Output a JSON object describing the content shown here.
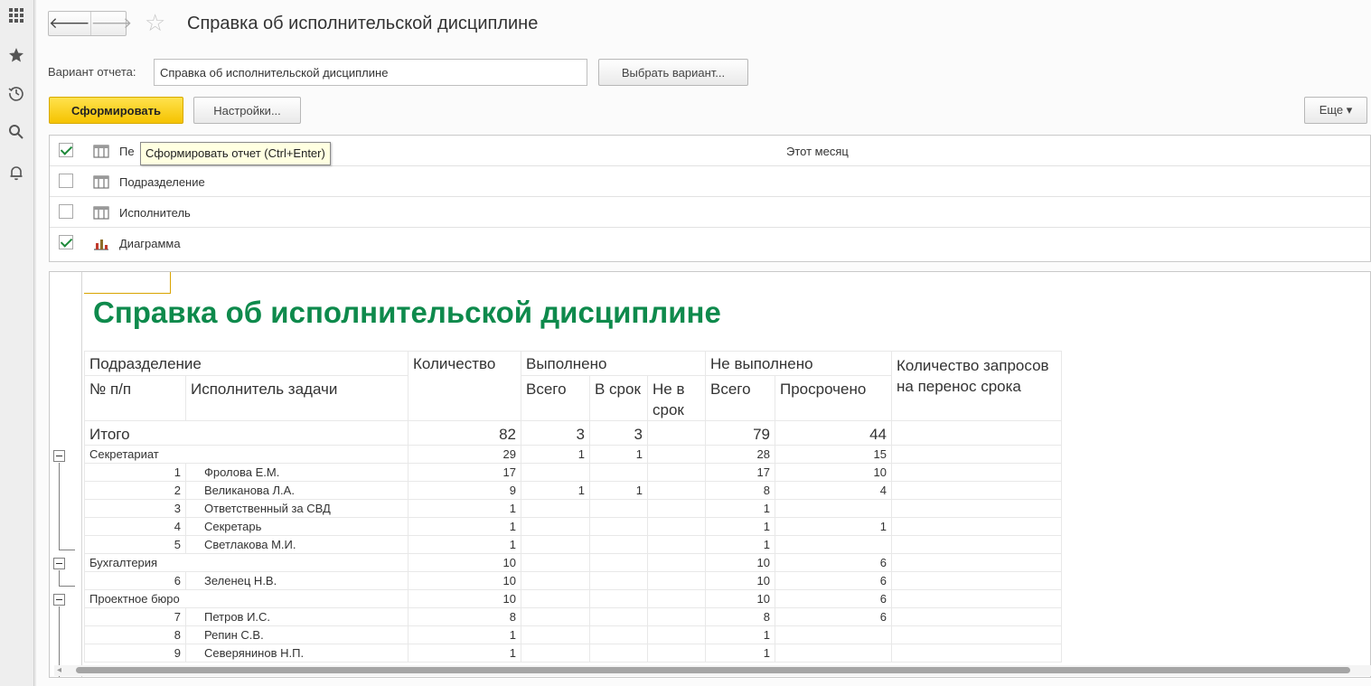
{
  "side_panel": {
    "items": [
      {
        "icon": "apps-grid-icon"
      },
      {
        "icon": "favorites-star-icon"
      },
      {
        "icon": "history-icon"
      },
      {
        "icon": "search-icon"
      },
      {
        "icon": "notifications-bell-icon"
      }
    ]
  },
  "header": {
    "back_glyph": "🡐",
    "forward_glyph": "🡒",
    "favorite_glyph": "☆",
    "title": "Справка об исполнительской дисциплине"
  },
  "variant": {
    "label": "Вариант отчета:",
    "value": "Справка об исполнительской дисциплине",
    "choose_label": "Выбрать вариант..."
  },
  "toolbar": {
    "generate_label": "Сформировать",
    "settings_label": "Настройки...",
    "more_label": "Еще ▾",
    "tooltip": "Сформировать отчет (Ctrl+Enter)"
  },
  "settings": [
    {
      "checked": true,
      "icon": "grouping-icon",
      "label": "Пе",
      "value": "Этот месяц"
    },
    {
      "checked": false,
      "icon": "grouping-icon",
      "label": "Подразделение",
      "value": ""
    },
    {
      "checked": false,
      "icon": "grouping-icon",
      "label": "Исполнитель",
      "value": ""
    },
    {
      "checked": true,
      "icon": "chart-icon",
      "label": "Диаграмма",
      "value": ""
    }
  ],
  "report": {
    "title": "Справка об исполнительской дисциплине",
    "headers": {
      "department": "Подразделение",
      "count": "Количество",
      "done": "Выполнено",
      "not_done": "Не выполнено",
      "postpone_requests": "Количество запросов на перенос срока",
      "number": "№ п/п",
      "executor": "Исполнитель задачи",
      "done_total": "Всего",
      "done_on_time": "В срок",
      "done_late": "Не в срок",
      "not_done_total": "Всего",
      "overdue": "Просрочено"
    },
    "total": {
      "label": "Итого",
      "count": "82",
      "done_total": "3",
      "done_on_time": "3",
      "done_late": "",
      "not_done_total": "79",
      "overdue": "44",
      "postpone": ""
    },
    "rows": [
      {
        "type": "group",
        "name": "Секретариат",
        "count": "29",
        "done_total": "1",
        "done_on_time": "1",
        "done_late": "",
        "not_done_total": "28",
        "overdue": "15",
        "postpone": ""
      },
      {
        "type": "item",
        "num": "1",
        "name": "Фролова Е.М.",
        "count": "17",
        "done_total": "",
        "done_on_time": "",
        "done_late": "",
        "not_done_total": "17",
        "overdue": "10",
        "postpone": ""
      },
      {
        "type": "item",
        "num": "2",
        "name": "Великанова Л.А.",
        "count": "9",
        "done_total": "1",
        "done_on_time": "1",
        "done_late": "",
        "not_done_total": "8",
        "overdue": "4",
        "postpone": ""
      },
      {
        "type": "item",
        "num": "3",
        "name": "Ответственный за СВД",
        "count": "1",
        "done_total": "",
        "done_on_time": "",
        "done_late": "",
        "not_done_total": "1",
        "overdue": "",
        "postpone": ""
      },
      {
        "type": "item",
        "num": "4",
        "name": "Секретарь",
        "count": "1",
        "done_total": "",
        "done_on_time": "",
        "done_late": "",
        "not_done_total": "1",
        "overdue": "1",
        "postpone": ""
      },
      {
        "type": "item",
        "num": "5",
        "name": "Светлакова М.И.",
        "count": "1",
        "done_total": "",
        "done_on_time": "",
        "done_late": "",
        "not_done_total": "1",
        "overdue": "",
        "postpone": ""
      },
      {
        "type": "group",
        "name": "Бухгалтерия",
        "count": "10",
        "done_total": "",
        "done_on_time": "",
        "done_late": "",
        "not_done_total": "10",
        "overdue": "6",
        "postpone": ""
      },
      {
        "type": "item",
        "num": "6",
        "name": "Зеленец Н.В.",
        "count": "10",
        "done_total": "",
        "done_on_time": "",
        "done_late": "",
        "not_done_total": "10",
        "overdue": "6",
        "postpone": ""
      },
      {
        "type": "group",
        "name": "Проектное бюро",
        "count": "10",
        "done_total": "",
        "done_on_time": "",
        "done_late": "",
        "not_done_total": "10",
        "overdue": "6",
        "postpone": ""
      },
      {
        "type": "item",
        "num": "7",
        "name": "Петров И.С.",
        "count": "8",
        "done_total": "",
        "done_on_time": "",
        "done_late": "",
        "not_done_total": "8",
        "overdue": "6",
        "postpone": ""
      },
      {
        "type": "item",
        "num": "8",
        "name": "Репин С.В.",
        "count": "1",
        "done_total": "",
        "done_on_time": "",
        "done_late": "",
        "not_done_total": "1",
        "overdue": "",
        "postpone": ""
      },
      {
        "type": "item",
        "num": "9",
        "name": "Северянинов Н.П.",
        "count": "1",
        "done_total": "",
        "done_on_time": "",
        "done_late": "",
        "not_done_total": "1",
        "overdue": "",
        "postpone": ""
      }
    ]
  },
  "colors": {
    "accent_yellow": "#f5c300",
    "report_title_green": "#0e8a4c",
    "check_green": "#1f8a3b"
  }
}
